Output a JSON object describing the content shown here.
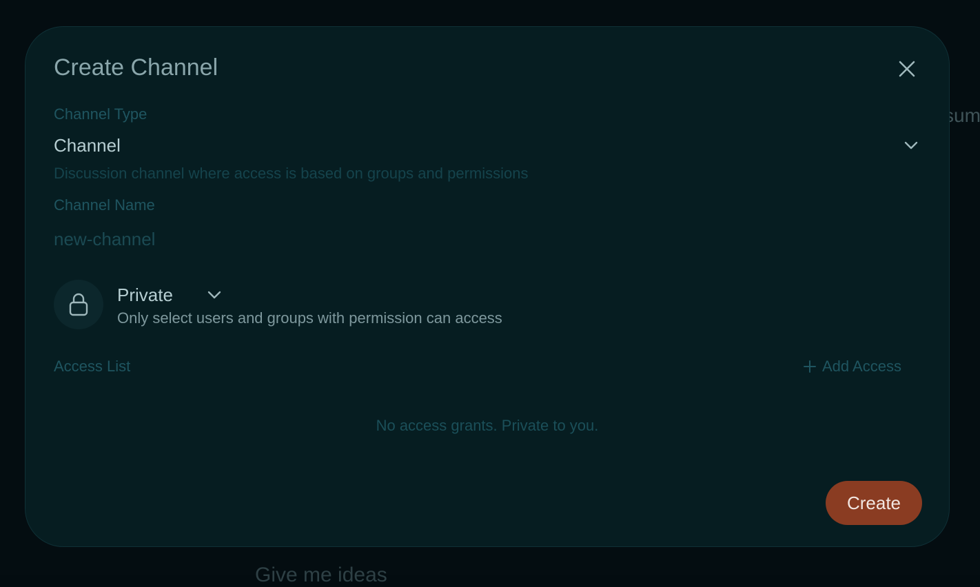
{
  "background": {
    "peek_right": "sum",
    "peek_bottom": "Give me ideas"
  },
  "modal": {
    "title": "Create Channel",
    "close_icon": "close-icon",
    "channel_type": {
      "label": "Channel Type",
      "value": "Channel",
      "description": "Discussion channel where access is based on groups and permissions"
    },
    "channel_name": {
      "label": "Channel Name",
      "value": "",
      "placeholder": "new-channel"
    },
    "privacy": {
      "icon": "lock-icon",
      "value": "Private",
      "description": "Only select users and groups with permission can access"
    },
    "access_list": {
      "label": "Access List",
      "add_label": "Add Access",
      "empty_text": "No access grants. Private to you."
    },
    "create_label": "Create"
  },
  "colors": {
    "accent": "#8a3c22",
    "modal_bg": "#061d21",
    "muted_teal": "#1f5560"
  }
}
